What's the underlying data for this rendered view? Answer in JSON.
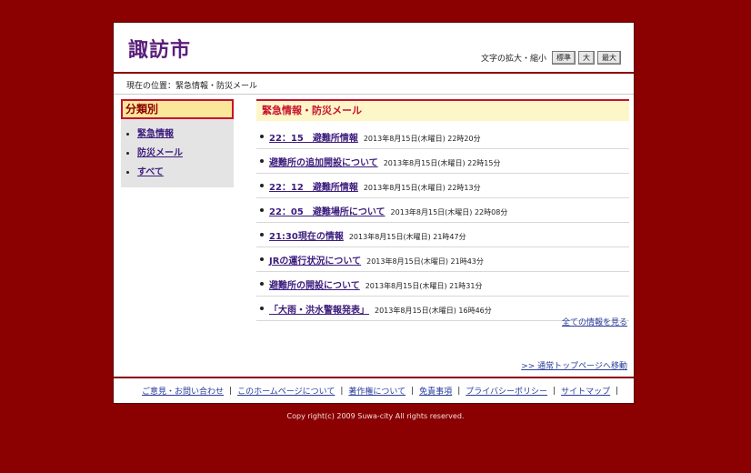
{
  "header": {
    "logo": "諏訪市",
    "font_size_label": "文字の拡大・縮小",
    "font_buttons": [
      "標準",
      "大",
      "最大"
    ]
  },
  "breadcrumb": "現在の位置：緊急情報・防災メール",
  "sidebar": {
    "title": "分類別",
    "items": [
      {
        "label": "緊急情報"
      },
      {
        "label": "防災メール"
      },
      {
        "label": "すべて"
      }
    ]
  },
  "main": {
    "title": "緊急情報・防災メール",
    "items": [
      {
        "title": "22：15　避難所情報",
        "date": "2013年8月15日(木曜日) 22時20分"
      },
      {
        "title": "避難所の追加開設について",
        "date": "2013年8月15日(木曜日) 22時15分"
      },
      {
        "title": "22：12　避難所情報",
        "date": "2013年8月15日(木曜日) 22時13分"
      },
      {
        "title": "22：05　避難場所について",
        "date": "2013年8月15日(木曜日) 22時08分"
      },
      {
        "title": "21:30現在の情報",
        "date": "2013年8月15日(木曜日) 21時47分"
      },
      {
        "title": "JRの運行状況について",
        "date": "2013年8月15日(木曜日) 21時43分"
      },
      {
        "title": "避難所の開設について",
        "date": "2013年8月15日(木曜日) 21時31分"
      },
      {
        "title": "「大雨・洪水警報発表」",
        "date": "2013年8月15日(木曜日) 16時46分"
      }
    ],
    "more_link": "全ての情報を見る",
    "top_link": ">> 通常トップページへ移動"
  },
  "footer": {
    "links": [
      "ご意見・お問い合わせ",
      "このホームページについて",
      "著作権について",
      "免責事項",
      "プライバシーポリシー",
      "サイトマップ"
    ],
    "copyright": "Copy right(c) 2009 Suwa-city All rights reserved."
  },
  "colors": {
    "background": "#8b0000",
    "accent_red": "#c8102e",
    "link_purple": "#3d1d7d",
    "link_blue": "#2a3d9c"
  }
}
